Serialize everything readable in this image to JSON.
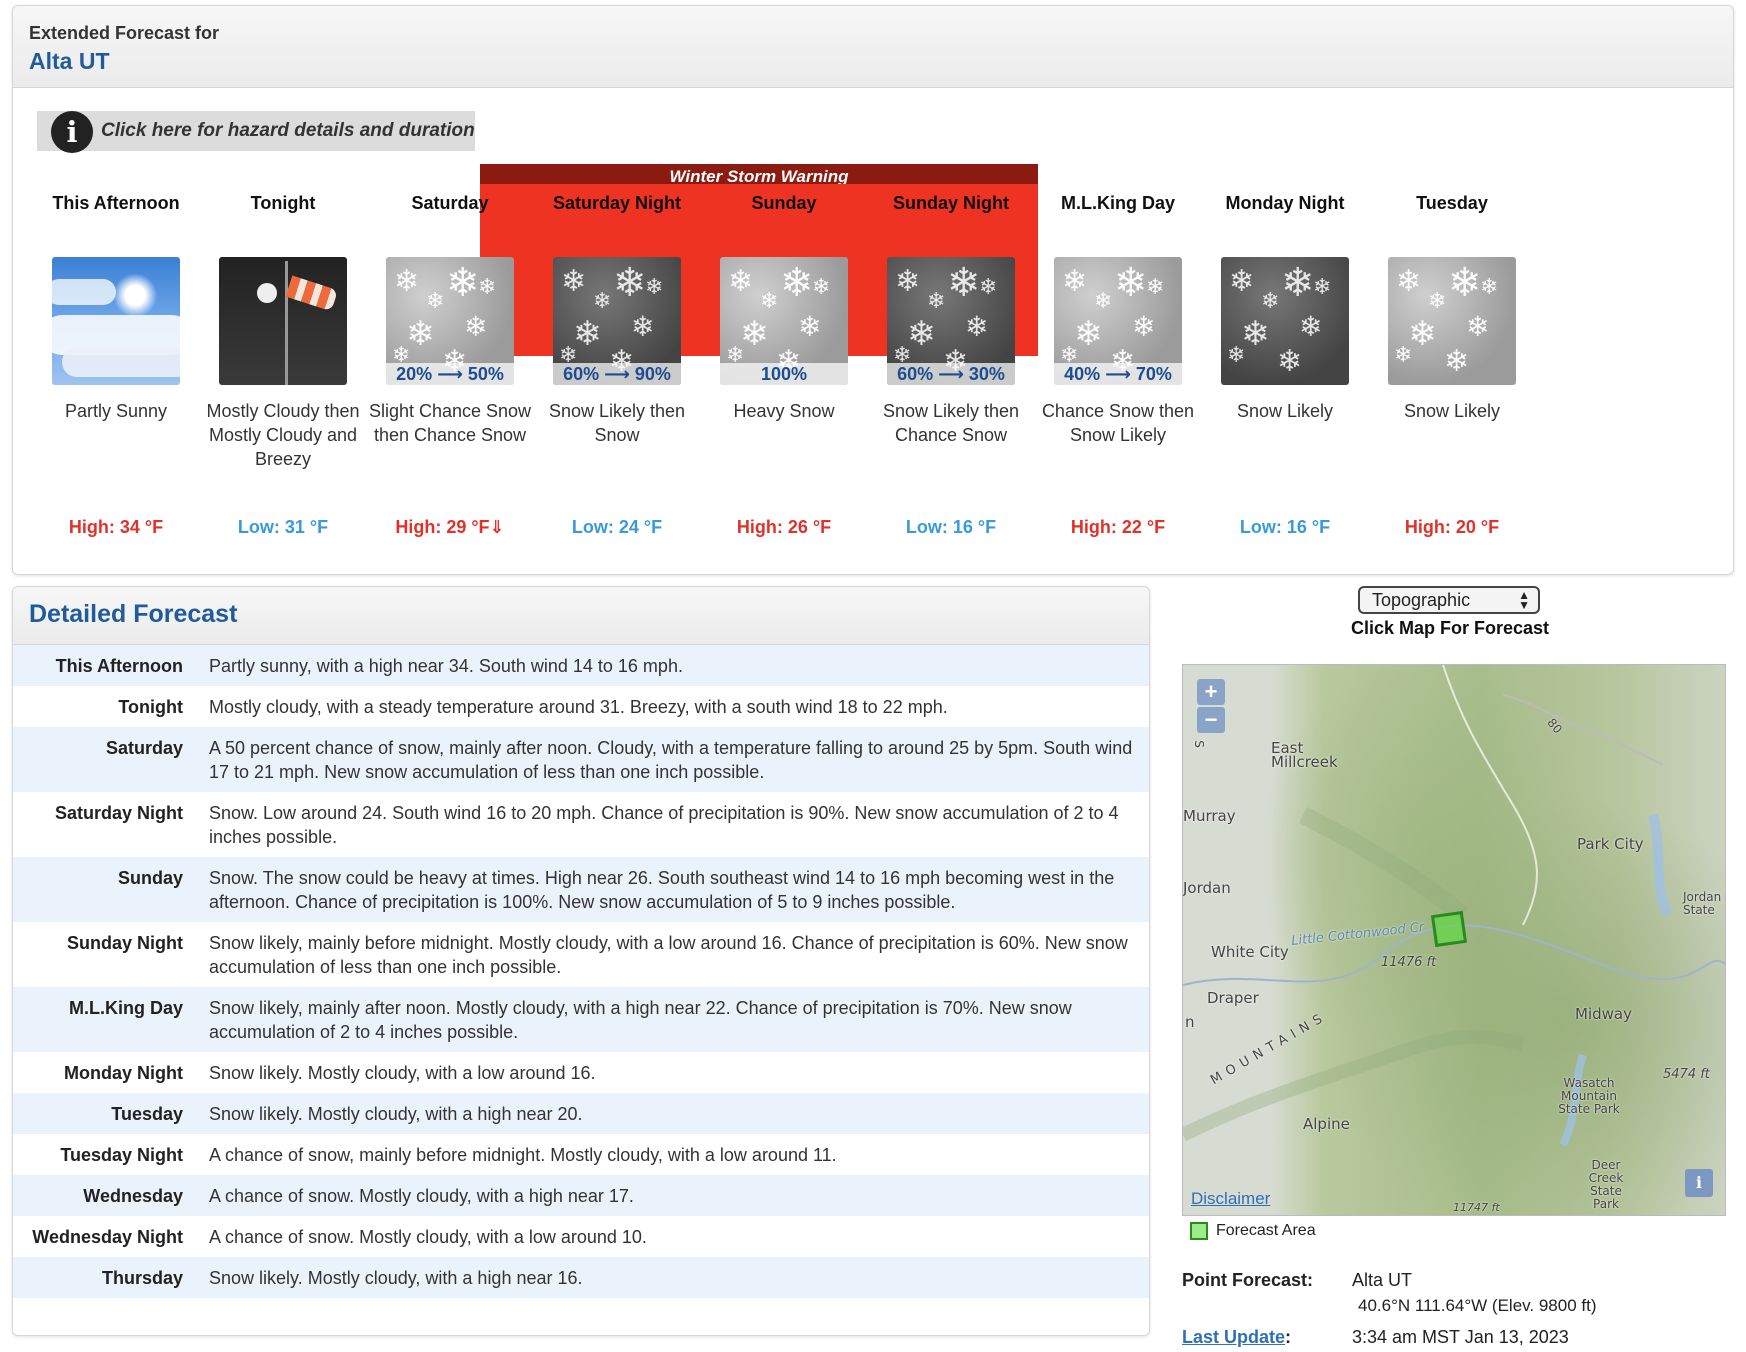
{
  "extended": {
    "subtitle": "Extended Forecast for",
    "location": "Alta UT",
    "hazard_link": "Click here for hazard details and duration",
    "hazard_icon": "i",
    "warning_label": "Winter Storm Warning",
    "periods": [
      {
        "name": "This Afternoon",
        "icon": "partly-sunny-icon",
        "pop": "",
        "desc": "Partly Sunny",
        "temp": "High: 34 °F",
        "temp_type": "high"
      },
      {
        "name": "Tonight",
        "icon": "breezy-night-icon",
        "pop": "",
        "desc": "Mostly Cloudy then Mostly Cloudy and Breezy",
        "temp": "Low: 31 °F",
        "temp_type": "low"
      },
      {
        "name": "Saturday",
        "icon": "snow-icon",
        "pop": "20% ⟶ 50%",
        "desc": "Slight Chance Snow then Chance Snow",
        "temp": "High: 29 °F⇓",
        "temp_type": "high"
      },
      {
        "name": "Saturday Night",
        "icon": "snow-night-icon",
        "pop": "60% ⟶ 90%",
        "desc": "Snow Likely then Snow",
        "temp": "Low: 24 °F",
        "temp_type": "low"
      },
      {
        "name": "Sunday",
        "icon": "snow-icon",
        "pop": "100%",
        "desc": "Heavy Snow",
        "temp": "High: 26 °F",
        "temp_type": "high"
      },
      {
        "name": "Sunday Night",
        "icon": "snow-night-icon",
        "pop": "60% ⟶ 30%",
        "desc": "Snow Likely then Chance Snow",
        "temp": "Low: 16 °F",
        "temp_type": "low"
      },
      {
        "name": "M.L.King Day",
        "icon": "snow-icon",
        "pop": "40% ⟶ 70%",
        "desc": "Chance Snow then Snow Likely",
        "temp": "High: 22 °F",
        "temp_type": "high"
      },
      {
        "name": "Monday Night",
        "icon": "snow-night-icon",
        "pop": "",
        "desc": "Snow Likely",
        "temp": "Low: 16 °F",
        "temp_type": "low"
      },
      {
        "name": "Tuesday",
        "icon": "snow-icon",
        "pop": "",
        "desc": "Snow Likely",
        "temp": "High: 20 °F",
        "temp_type": "high"
      }
    ]
  },
  "detailed": {
    "title": "Detailed Forecast",
    "rows": [
      {
        "label": "This Afternoon",
        "text": "Partly sunny, with a high near 34. South wind 14 to 16 mph."
      },
      {
        "label": "Tonight",
        "text": "Mostly cloudy, with a steady temperature around 31. Breezy, with a south wind 18 to 22 mph."
      },
      {
        "label": "Saturday",
        "text": "A 50 percent chance of snow, mainly after noon. Cloudy, with a temperature falling to around 25 by 5pm. South wind 17 to 21 mph. New snow accumulation of less than one inch possible."
      },
      {
        "label": "Saturday Night",
        "text": "Snow. Low around 24. South wind 16 to 20 mph. Chance of precipitation is 90%. New snow accumulation of 2 to 4 inches possible."
      },
      {
        "label": "Sunday",
        "text": "Snow. The snow could be heavy at times. High near 26. South southeast wind 14 to 16 mph becoming west in the afternoon. Chance of precipitation is 100%. New snow accumulation of 5 to 9 inches possible."
      },
      {
        "label": "Sunday Night",
        "text": "Snow likely, mainly before midnight. Mostly cloudy, with a low around 16. Chance of precipitation is 60%. New snow accumulation of less than one inch possible."
      },
      {
        "label": "M.L.King Day",
        "text": "Snow likely, mainly after noon. Mostly cloudy, with a high near 22. Chance of precipitation is 70%. New snow accumulation of 2 to 4 inches possible."
      },
      {
        "label": "Monday Night",
        "text": "Snow likely. Mostly cloudy, with a low around 16."
      },
      {
        "label": "Tuesday",
        "text": "Snow likely. Mostly cloudy, with a high near 20."
      },
      {
        "label": "Tuesday Night",
        "text": "A chance of snow, mainly before midnight. Mostly cloudy, with a low around 11."
      },
      {
        "label": "Wednesday",
        "text": "A chance of snow. Mostly cloudy, with a high near 17."
      },
      {
        "label": "Wednesday Night",
        "text": "A chance of snow. Mostly cloudy, with a low around 10."
      },
      {
        "label": "Thursday",
        "text": "Snow likely. Mostly cloudy, with a high near 16."
      }
    ]
  },
  "map": {
    "select_value": "Topographic",
    "caption": "Click Map For Forecast",
    "zoom_in": "+",
    "zoom_out": "−",
    "labels": {
      "east_millcreek": "East Millcreek",
      "murray": "Murray",
      "park_city": "Park City",
      "jordan": "Jordan",
      "jordan_state": "Jordan State",
      "little_cottonwood": "Little Cottonwood Cr",
      "white_city": "White City",
      "elev1": "11476 ft",
      "draper": "Draper",
      "midway": "Midway",
      "mountains": "MOUNTAINS",
      "wasatch": "Wasatch Mountain State Park",
      "elev2": "5474 ft",
      "alpine": "Alpine",
      "deer_creek": "Deer Creek State Park",
      "elev3": "11747 ft",
      "road": "80",
      "n": "n",
      "s": "S"
    },
    "disclaimer": "Disclaimer",
    "info_icon": "i",
    "legend": "Forecast Area"
  },
  "point_forecast": {
    "label": "Point Forecast:",
    "location": "Alta UT",
    "coords": "40.6°N 111.64°W (Elev. 9800 ft)",
    "last_update_label": "Last Update",
    "last_update_colon": ":",
    "last_update_value": "3:34 am MST Jan 13, 2023"
  },
  "colors": {
    "high_temp": "#e0322a",
    "low_temp": "#3a9ad9",
    "warning": "#ee3322",
    "warning_bar": "#8b1a10",
    "heading_blue": "#215b9c"
  }
}
